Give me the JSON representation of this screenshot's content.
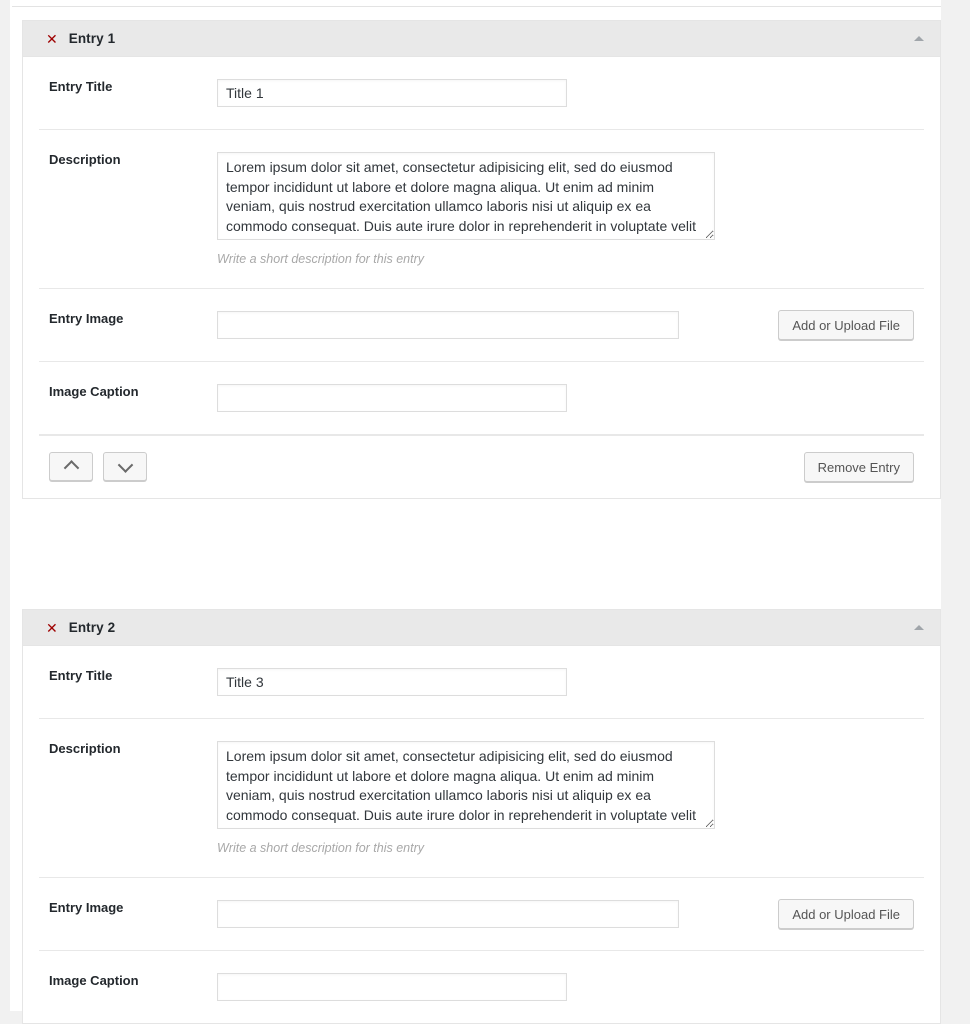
{
  "icons": {
    "remove_x": "✕",
    "collapse_toggle": "triangle-up",
    "move_up": "chevron-up",
    "move_down": "chevron-down"
  },
  "colors": {
    "page_background": "#f1f1f1",
    "panel_background": "#ffffff",
    "header_background": "#e9e9e9",
    "border": "#e5e5e5",
    "remove_x": "#9e0000",
    "help_text": "#a8a8a8",
    "label_text": "#23282d",
    "button_face": "#f7f7f7"
  },
  "labels": {
    "entry_title": "Entry Title",
    "description": "Description",
    "entry_image": "Entry Image",
    "image_caption": "Image Caption"
  },
  "help": {
    "description": "Write a short description for this entry"
  },
  "buttons": {
    "upload": "Add or Upload File",
    "remove_entry": "Remove Entry",
    "move_up": "",
    "move_down": ""
  },
  "placeholders": {
    "entry_title": "",
    "entry_image": "",
    "image_caption": "",
    "description": ""
  },
  "lorem": "Lorem ipsum dolor sit amet, consectetur adipisicing elit, sed do eiusmod tempor incididunt ut labore et dolore magna aliqua. Ut enim ad minim veniam, quis nostrud exercitation ullamco laboris nisi ut aliquip ex ea commodo consequat. Duis aute irure dolor in reprehenderit in voluptate velit esse cillum dolore eu fugiat nulla pariatur. Excepteur sint occaecat cupidatat non proident.",
  "entries": [
    {
      "header": "Entry 1",
      "title_value": "Title 1",
      "description_value": "Lorem ipsum dolor sit amet, consectetur adipisicing elit, sed do eiusmod tempor incididunt ut labore et dolore magna aliqua. Ut enim ad minim veniam, quis nostrud exercitation ullamco laboris nisi ut aliquip ex ea commodo consequat. Duis aute irure dolor in reprehenderit in voluptate velit esse cillum dolore eu fugiat nulla pariatur. Excepteur sint occaecat cupidatat non proident.",
      "image_value": "",
      "caption_value": ""
    },
    {
      "header": "Entry 2",
      "title_value": "Title 3",
      "description_value": "Lorem ipsum dolor sit amet, consectetur adipisicing elit, sed do eiusmod tempor incididunt ut labore et dolore magna aliqua. Ut enim ad minim veniam, quis nostrud exercitation ullamco laboris nisi ut aliquip ex ea commodo consequat. Duis aute irure dolor in reprehenderit in voluptate velit esse cillum dolore eu fugiat nulla pariatur. Excepteur sint occaecat cupidatat non proident.",
      "image_value": "",
      "caption_value": ""
    }
  ]
}
